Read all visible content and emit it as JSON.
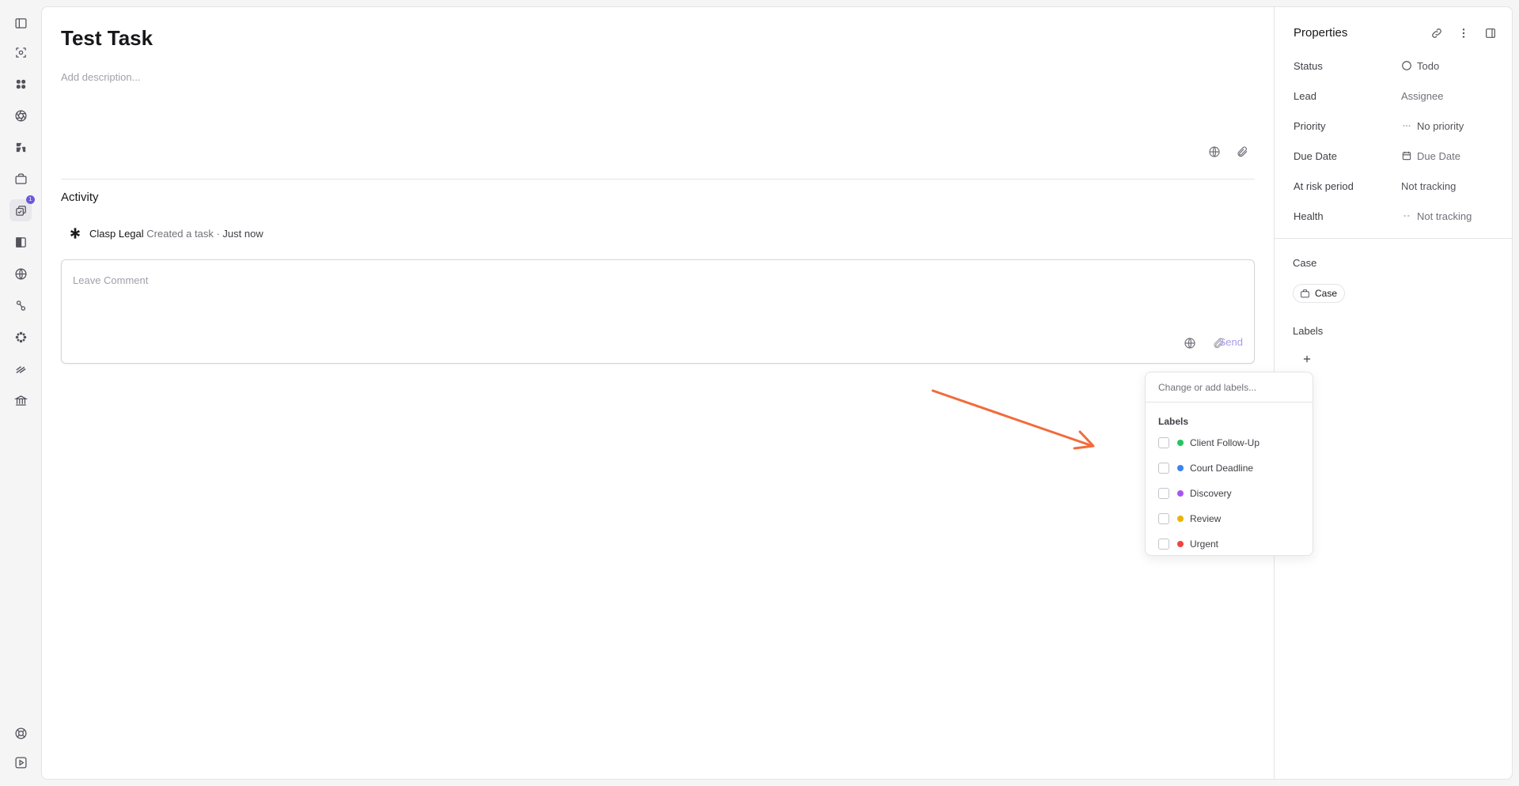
{
  "rail": {
    "items": [
      {
        "icon": "sidebar-toggle-icon"
      },
      {
        "icon": "scan-icon"
      },
      {
        "icon": "grid-icon"
      },
      {
        "icon": "aperture-icon"
      },
      {
        "icon": "profile-icon"
      },
      {
        "icon": "briefcase-icon"
      },
      {
        "icon": "tasks-icon",
        "badge": "1",
        "active": true
      },
      {
        "icon": "panel-icon"
      },
      {
        "icon": "globe-icon"
      },
      {
        "icon": "link-icon"
      },
      {
        "icon": "apps-icon"
      },
      {
        "icon": "strikes-icon"
      },
      {
        "icon": "bank-icon"
      }
    ],
    "bottom": [
      {
        "icon": "help-icon"
      },
      {
        "icon": "play-icon"
      }
    ]
  },
  "task": {
    "title": "Test Task",
    "description_placeholder": "Add description..."
  },
  "activity": {
    "heading": "Activity",
    "entries": [
      {
        "actor": "Clasp Legal",
        "action": "Created a task",
        "separator": "·",
        "time": "Just now"
      }
    ]
  },
  "comment": {
    "placeholder": "Leave Comment",
    "send_label": "Send"
  },
  "properties": {
    "title": "Properties",
    "rows": [
      {
        "label": "Status",
        "value": "Todo",
        "icon": "circle-icon"
      },
      {
        "label": "Lead",
        "value": "Assignee"
      },
      {
        "label": "Priority",
        "value": "No priority",
        "icon": "dots-icon"
      },
      {
        "label": "Due Date",
        "value": "Due Date",
        "icon": "calendar-icon"
      },
      {
        "label": "At risk period",
        "value": "Not tracking"
      },
      {
        "label": "Health",
        "value": "Not tracking",
        "icon": "dash-icon"
      }
    ],
    "case_heading": "Case",
    "case_chip": "Case",
    "labels_heading": "Labels"
  },
  "labels_dropdown": {
    "placeholder": "Change or add labels...",
    "heading": "Labels",
    "items": [
      {
        "name": "Client Follow-Up",
        "color": "#22c55e"
      },
      {
        "name": "Court Deadline",
        "color": "#3b82f6"
      },
      {
        "name": "Discovery",
        "color": "#a855f7"
      },
      {
        "name": "Review",
        "color": "#eab308"
      },
      {
        "name": "Urgent",
        "color": "#ef4444"
      }
    ]
  },
  "annotation": {
    "arrow_color": "#f26b3a"
  }
}
